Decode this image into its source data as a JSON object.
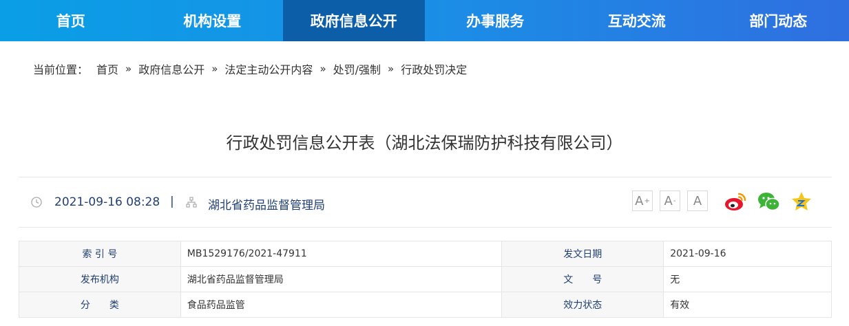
{
  "nav": {
    "items": [
      {
        "label": "首页"
      },
      {
        "label": "机构设置"
      },
      {
        "label": "政府信息公开"
      },
      {
        "label": "办事服务"
      },
      {
        "label": "互动交流"
      },
      {
        "label": "部门动态"
      }
    ],
    "active_index": 2
  },
  "breadcrumb": {
    "prefix": "当前位置：",
    "separator": "»",
    "items": [
      "首页",
      "政府信息公开",
      "法定主动公开内容",
      "处罚/强制",
      "行政处罚决定"
    ]
  },
  "article": {
    "title": "行政处罚信息公开表（湖北法保瑞防护科技有限公司）",
    "date": "2021-09-16 08:28",
    "divider": "|",
    "publisher": "湖北省药品监督管理局"
  },
  "font_controls": {
    "increase": {
      "letter": "A",
      "mark": "+"
    },
    "decrease": {
      "letter": "A",
      "mark": "-"
    },
    "reset": {
      "letter": "A"
    }
  },
  "share_icons": [
    "weibo-icon",
    "wechat-icon",
    "favorite-star-icon"
  ],
  "colors": {
    "nav_start": "#0a9ee6",
    "nav_end": "#2f6fe0",
    "nav_active": "#0d5ea8",
    "label_text": "#1f3f75",
    "weibo": "#e6162d",
    "wechat": "#3db337",
    "star": "#f5c518"
  },
  "info_table": {
    "rows": [
      {
        "label1": "索 引 号",
        "value1": "MB1529176/2021-47911",
        "label2": "发文日期",
        "value2": "2021-09-16"
      },
      {
        "label1": "发布机构",
        "value1": "湖北省药品监督管理局",
        "label2": "文　　号",
        "value2": "无"
      },
      {
        "label1": "分　　类",
        "value1": "食品药品监管",
        "label2": "效力状态",
        "value2": "有效"
      }
    ]
  }
}
